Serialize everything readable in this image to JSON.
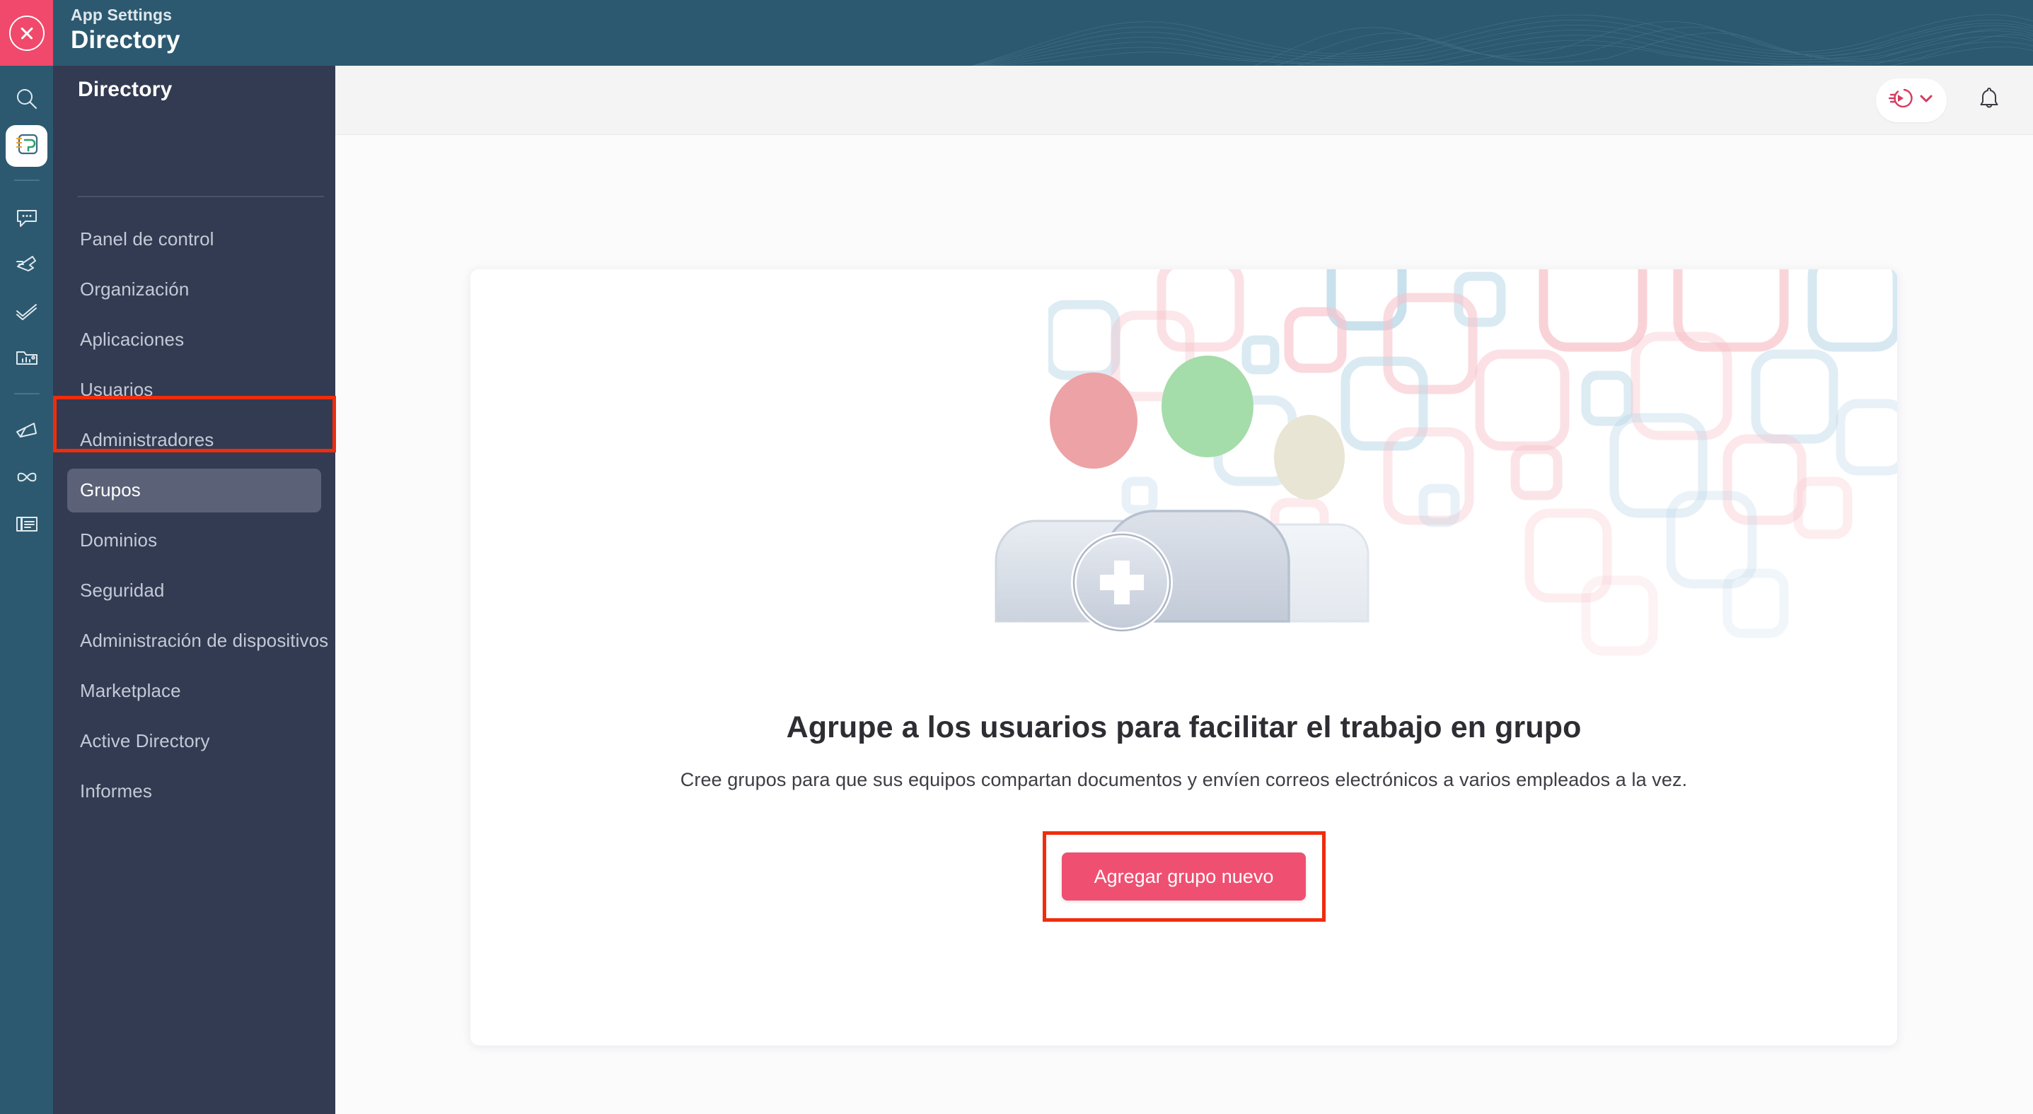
{
  "topbar": {
    "eyebrow": "App Settings",
    "title": "Directory",
    "close_icon": "close-circle-icon"
  },
  "rail": {
    "items": [
      {
        "name": "search-icon",
        "label": "Search",
        "active": false
      },
      {
        "name": "directory-app-icon",
        "label": "Directory",
        "active": true
      },
      {
        "name": "chat-icon",
        "label": "Chat",
        "active": false
      },
      {
        "name": "connect-icon",
        "label": "Connect",
        "active": false
      },
      {
        "name": "tasks-icon",
        "label": "Tasks",
        "active": false
      },
      {
        "name": "analytics-icon",
        "label": "Analytics",
        "active": false
      },
      {
        "name": "campaign-icon",
        "label": "Campaigns",
        "active": false
      },
      {
        "name": "integrations-icon",
        "label": "Integrations",
        "active": false
      },
      {
        "name": "documents-icon",
        "label": "Documents",
        "active": false
      }
    ]
  },
  "sidebar": {
    "title": "Directory",
    "items": [
      {
        "label": "Panel de control",
        "active": false
      },
      {
        "label": "Organización",
        "active": false
      },
      {
        "label": "Aplicaciones",
        "active": false
      },
      {
        "label": "Usuarios",
        "active": false
      },
      {
        "label": "Administradores",
        "active": false
      },
      {
        "label": "Grupos",
        "active": true
      },
      {
        "label": "Dominios",
        "active": false
      },
      {
        "label": "Seguridad",
        "active": false
      },
      {
        "label": "Administración de dispositivos",
        "active": false
      },
      {
        "label": "Marketplace",
        "active": false
      },
      {
        "label": "Active Directory",
        "active": false
      },
      {
        "label": "Informes",
        "active": false
      }
    ]
  },
  "header": {
    "app_switcher_icon": "app-switcher-icon",
    "chevron_icon": "chevron-down-icon",
    "notifications_icon": "bell-icon"
  },
  "main": {
    "illustration": "group-of-users-add-illustration",
    "heading": "Agrupe a los usuarios para facilitar el trabajo en grupo",
    "subheading": "Cree grupos para que sus equipos compartan documentos y envíen correos electrónicos a varios empleados a la vez.",
    "cta_label": "Agregar grupo nuevo"
  },
  "colors": {
    "topbar": "#2c5970",
    "close_tile": "#f0496b",
    "sidebar": "#333b52",
    "sidebar_active_pill": "#5b6277",
    "highlight_outline": "#f02c0c",
    "cta": "#ef5072",
    "content_bg": "#fbfbfc",
    "card": "#ffffff"
  }
}
